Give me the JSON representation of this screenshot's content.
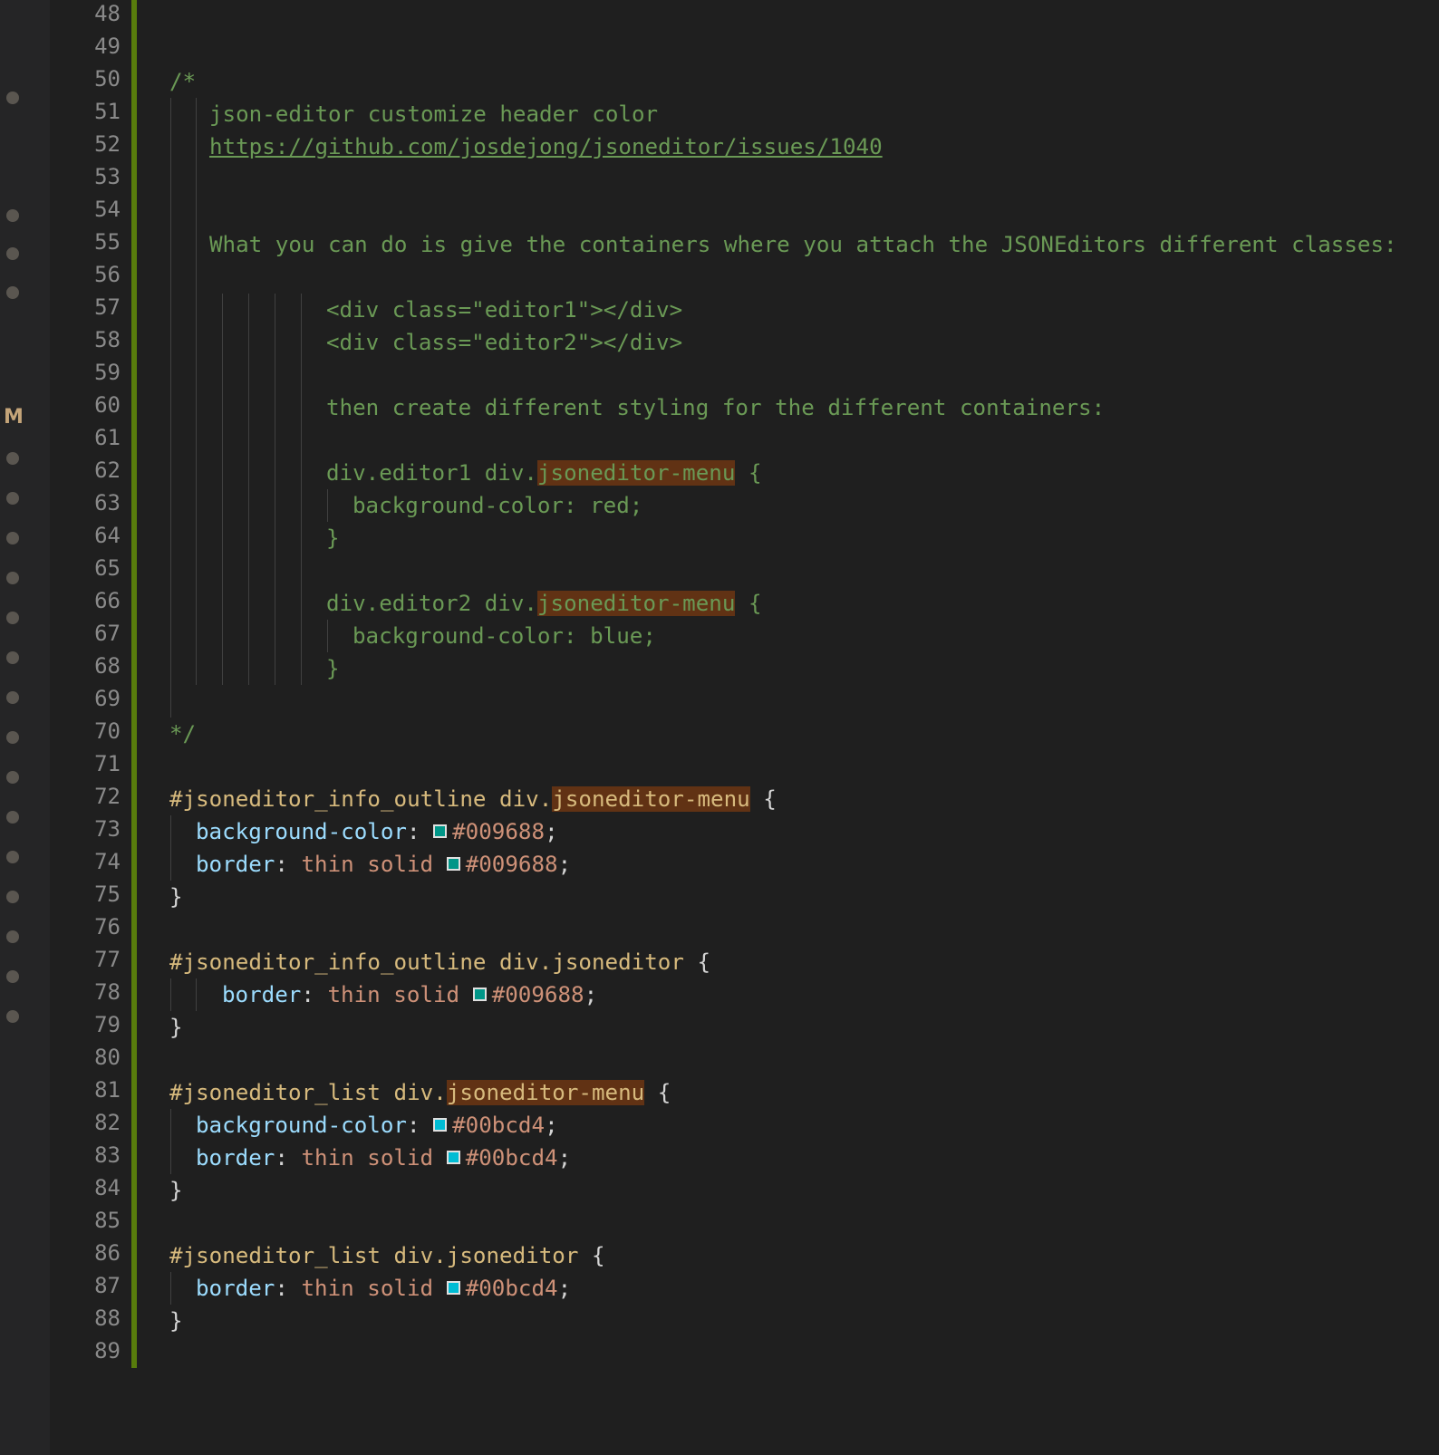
{
  "colors": {
    "teal": "#009688",
    "cyan": "#00bcd4",
    "change_bar": "#587c0c"
  },
  "gutter_glyph": "M",
  "code": {
    "l48": "",
    "l49": "",
    "l50": "/*",
    "l51": "json-editor customize header color",
    "l52": "https://github.com/josdejong/jsoneditor/issues/1040",
    "l55": "What you can do is give the containers where you attach the JSONEditors different classes:",
    "l57": "<div class=\"editor1\"></div>",
    "l58": "<div class=\"editor2\"></div>",
    "l60": "then create different styling for the different containers:",
    "l62_a": "div.editor1 div.",
    "l62_b": "jsoneditor-menu",
    "l62_c": " {",
    "l63": "background-color: red;",
    "l64": "}",
    "l66_a": "div.editor2 div.",
    "l66_b": "jsoneditor-menu",
    "l66_c": " {",
    "l67": "background-color: blue;",
    "l68": "}",
    "l70": "*/",
    "l72_a": "#jsoneditor_info_outline div.",
    "l72_b": "jsoneditor-menu",
    "l72_c": " {",
    "l73_prop": "background-color",
    "l73_val": "#009688",
    "l74_prop": "border",
    "l74_val1": "thin solid",
    "l74_val2": "#009688",
    "l75": "}",
    "l77_a": "#jsoneditor_info_outline div.jsoneditor",
    "l77_c": " {",
    "l78_prop": "border",
    "l78_val1": "thin solid",
    "l78_val2": "#009688",
    "l79": "}",
    "l81_a": "#jsoneditor_list div.",
    "l81_b": "jsoneditor-menu",
    "l81_c": " {",
    "l82_prop": "background-color",
    "l82_val": "#00bcd4",
    "l83_prop": "border",
    "l83_val1": "thin solid",
    "l83_val2": "#00bcd4",
    "l84": "}",
    "l86_a": "#jsoneditor_list div.jsoneditor",
    "l86_c": " {",
    "l87_prop": "border",
    "l87_val1": "thin solid",
    "l87_val2": "#00bcd4",
    "l88": "}"
  },
  "line_numbers": [
    "48",
    "49",
    "50",
    "51",
    "52",
    "53",
    "54",
    "55",
    "56",
    "57",
    "58",
    "59",
    "60",
    "61",
    "62",
    "63",
    "64",
    "65",
    "66",
    "67",
    "68",
    "69",
    "70",
    "71",
    "72",
    "73",
    "74",
    "75",
    "76",
    "77",
    "78",
    "79",
    "80",
    "81",
    "82",
    "83",
    "84",
    "85",
    "86",
    "87",
    "88",
    "89"
  ]
}
